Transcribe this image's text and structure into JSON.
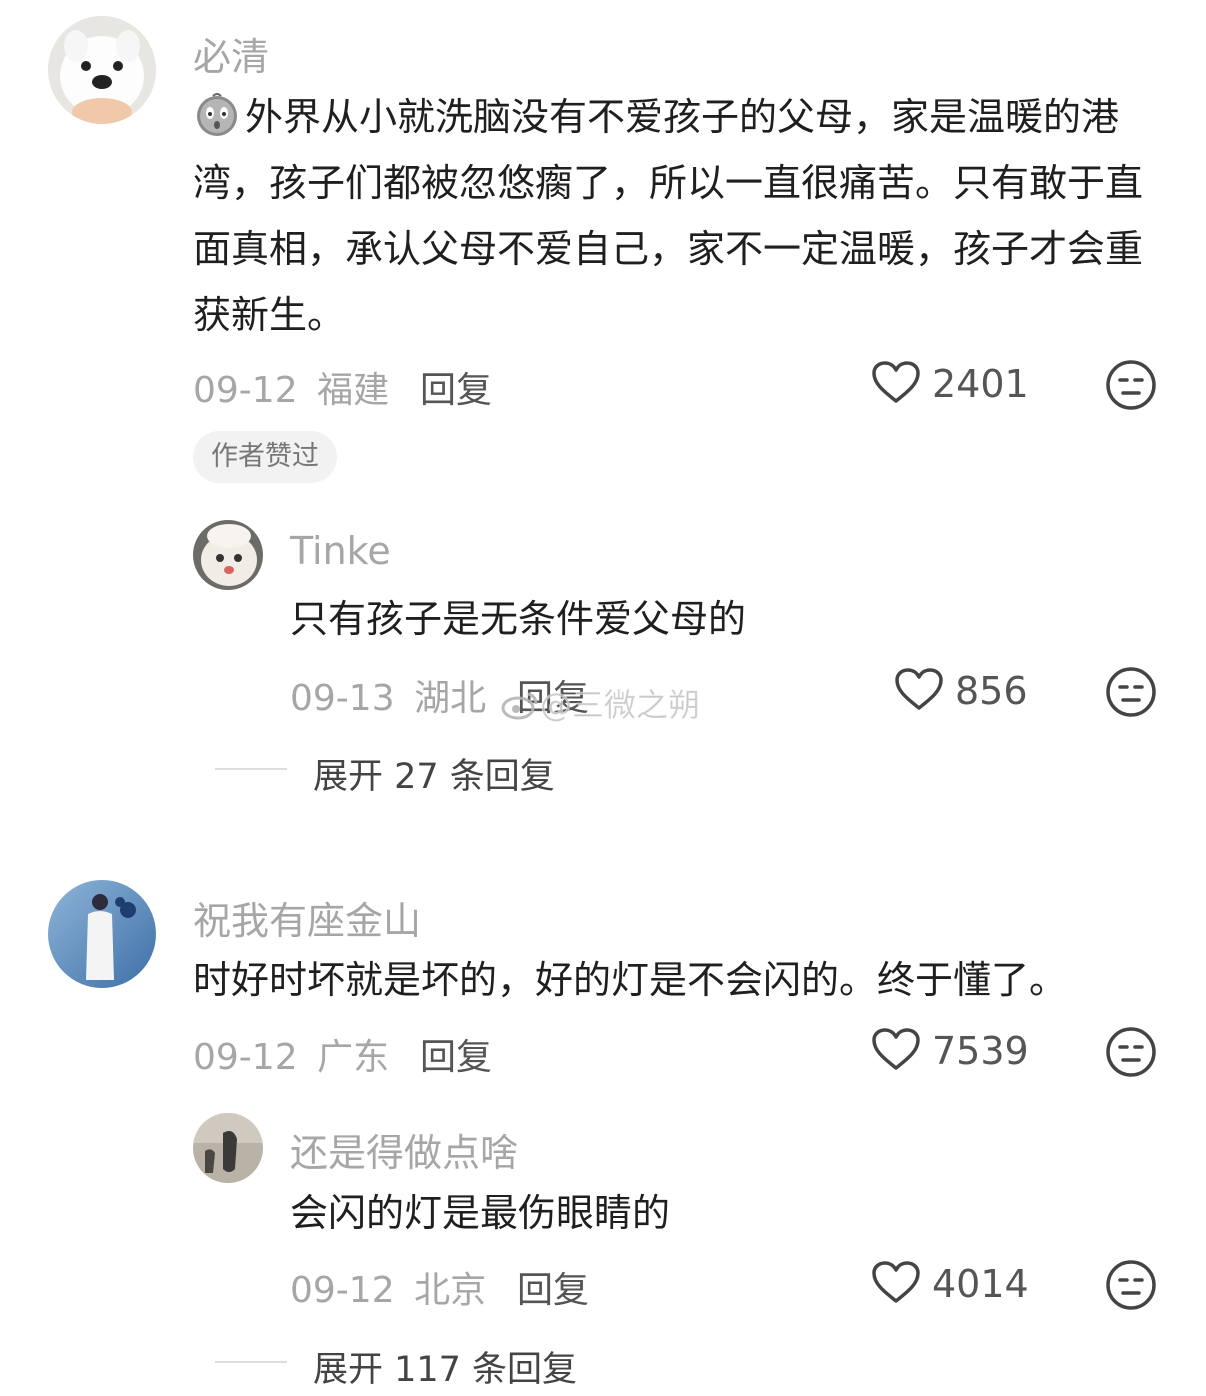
{
  "comments": [
    {
      "username": "必清",
      "text": "外界从小就洗脑没有不爱孩子的父母，家是温暖的港湾，孩子们都被忽悠瘸了，所以一直很痛苦。只有敢于直面真相，承认父母不爱自己，家不一定温暖，孩子才会重获新生。",
      "emoji_icon": "crying-face-emoji",
      "date": "09-12",
      "location": "福建",
      "reply_label": "回复",
      "likes": "2401",
      "badge": "作者赞过",
      "reply": {
        "username": "Tinke",
        "text": "只有孩子是无条件爱父母的",
        "date": "09-13",
        "location": "湖北",
        "reply_label": "回复",
        "likes": "856"
      },
      "expand_label": "展开 27 条回复"
    },
    {
      "username": "祝我有座金山",
      "text": "时好时坏就是坏的，好的灯是不会闪的。终于懂了。",
      "date": "09-12",
      "location": "广东",
      "reply_label": "回复",
      "likes": "7539",
      "reply": {
        "username": "还是得做点啥",
        "text": "会闪的灯是最伤眼睛的",
        "date": "09-12",
        "location": "北京",
        "reply_label": "回复",
        "likes": "4014"
      },
      "expand_label": "展开 117 条回复"
    }
  ],
  "watermark": "@三微之朔",
  "colors": {
    "meta_gray": "#a6a6a6",
    "text": "#1f1f1f",
    "badge_bg": "#f2f2f2"
  },
  "icons": {
    "like": "heart-outline-icon",
    "reaction": "neutral-face-icon"
  }
}
